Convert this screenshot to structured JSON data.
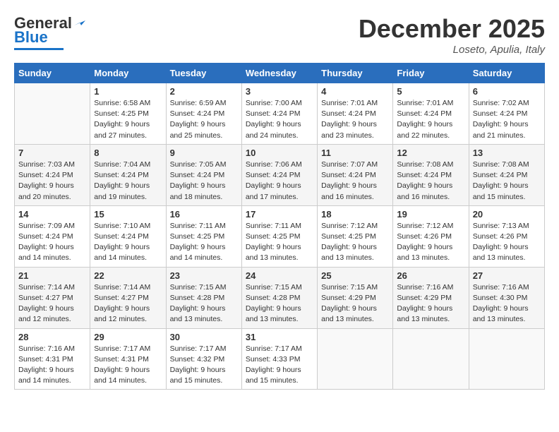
{
  "header": {
    "logo_general": "General",
    "logo_blue": "Blue",
    "month_title": "December 2025",
    "location": "Loseto, Apulia, Italy"
  },
  "days_of_week": [
    "Sunday",
    "Monday",
    "Tuesday",
    "Wednesday",
    "Thursday",
    "Friday",
    "Saturday"
  ],
  "weeks": [
    [
      {
        "day": "",
        "info": ""
      },
      {
        "day": "1",
        "info": "Sunrise: 6:58 AM\nSunset: 4:25 PM\nDaylight: 9 hours\nand 27 minutes."
      },
      {
        "day": "2",
        "info": "Sunrise: 6:59 AM\nSunset: 4:24 PM\nDaylight: 9 hours\nand 25 minutes."
      },
      {
        "day": "3",
        "info": "Sunrise: 7:00 AM\nSunset: 4:24 PM\nDaylight: 9 hours\nand 24 minutes."
      },
      {
        "day": "4",
        "info": "Sunrise: 7:01 AM\nSunset: 4:24 PM\nDaylight: 9 hours\nand 23 minutes."
      },
      {
        "day": "5",
        "info": "Sunrise: 7:01 AM\nSunset: 4:24 PM\nDaylight: 9 hours\nand 22 minutes."
      },
      {
        "day": "6",
        "info": "Sunrise: 7:02 AM\nSunset: 4:24 PM\nDaylight: 9 hours\nand 21 minutes."
      }
    ],
    [
      {
        "day": "7",
        "info": "Sunrise: 7:03 AM\nSunset: 4:24 PM\nDaylight: 9 hours\nand 20 minutes."
      },
      {
        "day": "8",
        "info": "Sunrise: 7:04 AM\nSunset: 4:24 PM\nDaylight: 9 hours\nand 19 minutes."
      },
      {
        "day": "9",
        "info": "Sunrise: 7:05 AM\nSunset: 4:24 PM\nDaylight: 9 hours\nand 18 minutes."
      },
      {
        "day": "10",
        "info": "Sunrise: 7:06 AM\nSunset: 4:24 PM\nDaylight: 9 hours\nand 17 minutes."
      },
      {
        "day": "11",
        "info": "Sunrise: 7:07 AM\nSunset: 4:24 PM\nDaylight: 9 hours\nand 16 minutes."
      },
      {
        "day": "12",
        "info": "Sunrise: 7:08 AM\nSunset: 4:24 PM\nDaylight: 9 hours\nand 16 minutes."
      },
      {
        "day": "13",
        "info": "Sunrise: 7:08 AM\nSunset: 4:24 PM\nDaylight: 9 hours\nand 15 minutes."
      }
    ],
    [
      {
        "day": "14",
        "info": "Sunrise: 7:09 AM\nSunset: 4:24 PM\nDaylight: 9 hours\nand 14 minutes."
      },
      {
        "day": "15",
        "info": "Sunrise: 7:10 AM\nSunset: 4:24 PM\nDaylight: 9 hours\nand 14 minutes."
      },
      {
        "day": "16",
        "info": "Sunrise: 7:11 AM\nSunset: 4:25 PM\nDaylight: 9 hours\nand 14 minutes."
      },
      {
        "day": "17",
        "info": "Sunrise: 7:11 AM\nSunset: 4:25 PM\nDaylight: 9 hours\nand 13 minutes."
      },
      {
        "day": "18",
        "info": "Sunrise: 7:12 AM\nSunset: 4:25 PM\nDaylight: 9 hours\nand 13 minutes."
      },
      {
        "day": "19",
        "info": "Sunrise: 7:12 AM\nSunset: 4:26 PM\nDaylight: 9 hours\nand 13 minutes."
      },
      {
        "day": "20",
        "info": "Sunrise: 7:13 AM\nSunset: 4:26 PM\nDaylight: 9 hours\nand 13 minutes."
      }
    ],
    [
      {
        "day": "21",
        "info": "Sunrise: 7:14 AM\nSunset: 4:27 PM\nDaylight: 9 hours\nand 12 minutes."
      },
      {
        "day": "22",
        "info": "Sunrise: 7:14 AM\nSunset: 4:27 PM\nDaylight: 9 hours\nand 12 minutes."
      },
      {
        "day": "23",
        "info": "Sunrise: 7:15 AM\nSunset: 4:28 PM\nDaylight: 9 hours\nand 13 minutes."
      },
      {
        "day": "24",
        "info": "Sunrise: 7:15 AM\nSunset: 4:28 PM\nDaylight: 9 hours\nand 13 minutes."
      },
      {
        "day": "25",
        "info": "Sunrise: 7:15 AM\nSunset: 4:29 PM\nDaylight: 9 hours\nand 13 minutes."
      },
      {
        "day": "26",
        "info": "Sunrise: 7:16 AM\nSunset: 4:29 PM\nDaylight: 9 hours\nand 13 minutes."
      },
      {
        "day": "27",
        "info": "Sunrise: 7:16 AM\nSunset: 4:30 PM\nDaylight: 9 hours\nand 13 minutes."
      }
    ],
    [
      {
        "day": "28",
        "info": "Sunrise: 7:16 AM\nSunset: 4:31 PM\nDaylight: 9 hours\nand 14 minutes."
      },
      {
        "day": "29",
        "info": "Sunrise: 7:17 AM\nSunset: 4:31 PM\nDaylight: 9 hours\nand 14 minutes."
      },
      {
        "day": "30",
        "info": "Sunrise: 7:17 AM\nSunset: 4:32 PM\nDaylight: 9 hours\nand 15 minutes."
      },
      {
        "day": "31",
        "info": "Sunrise: 7:17 AM\nSunset: 4:33 PM\nDaylight: 9 hours\nand 15 minutes."
      },
      {
        "day": "",
        "info": ""
      },
      {
        "day": "",
        "info": ""
      },
      {
        "day": "",
        "info": ""
      }
    ]
  ]
}
